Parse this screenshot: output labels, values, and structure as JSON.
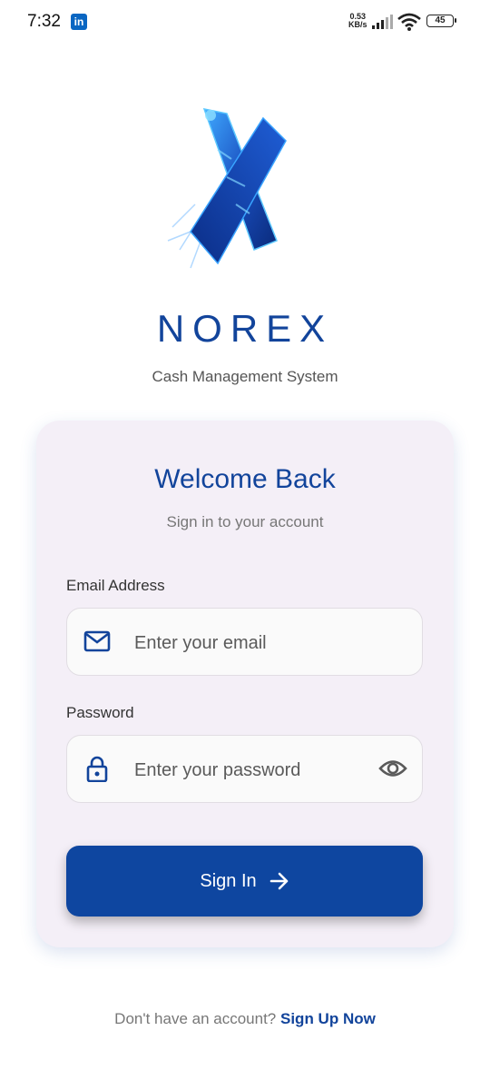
{
  "status_bar": {
    "time": "7:32",
    "notification_app": "in",
    "speed_value": "0.53",
    "speed_unit": "KB/s",
    "battery": "45"
  },
  "brand": {
    "name": "NOREX",
    "tagline": "Cash Management System",
    "logo_icon": "norex-x-logo-icon"
  },
  "login_card": {
    "title": "Welcome Back",
    "subtitle": "Sign in to your account",
    "email": {
      "label": "Email Address",
      "placeholder": "Enter your email",
      "value": "",
      "icon": "mail-icon"
    },
    "password": {
      "label": "Password",
      "placeholder": "Enter your password",
      "value": "",
      "icon": "lock-icon",
      "toggle_icon": "eye-icon"
    },
    "submit_label": "Sign In",
    "submit_icon": "arrow-right-icon"
  },
  "footer": {
    "prompt": "Don't have an account?",
    "link": "Sign Up Now"
  },
  "colors": {
    "brand_blue": "#12449b",
    "button_blue": "#0e46a0",
    "card_bg": "#f4eff7"
  }
}
